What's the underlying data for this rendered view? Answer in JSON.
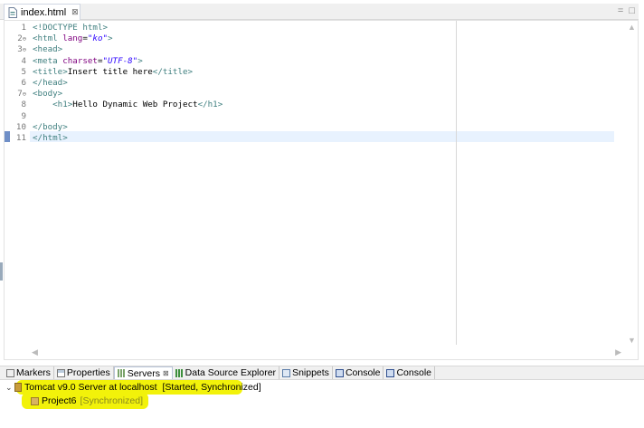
{
  "editor": {
    "tab": {
      "title": "index.html",
      "close_glyph": "⊠"
    },
    "view_controls": {
      "minimize": "=",
      "maximize": "□"
    },
    "lines": [
      {
        "num": "1",
        "fold": "",
        "segments": [
          {
            "t": "tag",
            "v": "<!DOCTYPE html>"
          }
        ]
      },
      {
        "num": "2",
        "fold": "⊖",
        "segments": [
          {
            "t": "tag",
            "v": "<html "
          },
          {
            "t": "attr",
            "v": "lang"
          },
          {
            "t": "txt",
            "v": "="
          },
          {
            "t": "val",
            "v": "\"ko\""
          },
          {
            "t": "tag",
            "v": ">"
          }
        ]
      },
      {
        "num": "3",
        "fold": "⊖",
        "segments": [
          {
            "t": "tag",
            "v": "<head>"
          }
        ]
      },
      {
        "num": "4",
        "fold": "",
        "segments": [
          {
            "t": "tag",
            "v": "<meta "
          },
          {
            "t": "attr",
            "v": "charset"
          },
          {
            "t": "txt",
            "v": "="
          },
          {
            "t": "val",
            "v": "\"UTF-8\""
          },
          {
            "t": "tag",
            "v": ">"
          }
        ]
      },
      {
        "num": "5",
        "fold": "",
        "segments": [
          {
            "t": "tag",
            "v": "<title>"
          },
          {
            "t": "txt",
            "v": "Insert title here"
          },
          {
            "t": "tag",
            "v": "</title>"
          }
        ]
      },
      {
        "num": "6",
        "fold": "",
        "segments": [
          {
            "t": "tag",
            "v": "</head>"
          }
        ]
      },
      {
        "num": "7",
        "fold": "⊖",
        "segments": [
          {
            "t": "tag",
            "v": "<body>"
          }
        ]
      },
      {
        "num": "8",
        "fold": "",
        "segments": [
          {
            "t": "txt",
            "v": "    "
          },
          {
            "t": "tag",
            "v": "<h1>"
          },
          {
            "t": "txt",
            "v": "Hello Dynamic Web Project"
          },
          {
            "t": "tag",
            "v": "</h1>"
          }
        ]
      },
      {
        "num": "9",
        "fold": "",
        "segments": []
      },
      {
        "num": "10",
        "fold": "",
        "segments": [
          {
            "t": "tag",
            "v": "</body>"
          }
        ]
      },
      {
        "num": "11",
        "fold": "",
        "segments": [
          {
            "t": "tag",
            "v": "</html>"
          }
        ]
      }
    ],
    "current_line": "11",
    "scroll": {
      "up": "▲",
      "down": "▼",
      "left": "◀",
      "right": "▶"
    }
  },
  "panel": {
    "tabs": [
      {
        "label": "Markers",
        "icon": "markers-icon",
        "active": false
      },
      {
        "label": "Properties",
        "icon": "properties-icon",
        "active": false
      },
      {
        "label": "Servers",
        "icon": "servers-icon",
        "active": true
      },
      {
        "label": "Data Source Explorer",
        "icon": "data-source-icon",
        "active": false
      },
      {
        "label": "Snippets",
        "icon": "snippets-icon",
        "active": false
      },
      {
        "label": "Console",
        "icon": "console-icon",
        "active": false
      },
      {
        "label": "Console",
        "icon": "console-icon",
        "active": false
      }
    ],
    "servers": [
      {
        "name": "Tomcat v9.0 Server at localhost",
        "status": "[Started, Synchronized]",
        "expanded": true,
        "children": [
          {
            "name": "Project6",
            "status": "[Synchronized]"
          }
        ]
      }
    ],
    "highlight_color": "#f2f20a"
  }
}
